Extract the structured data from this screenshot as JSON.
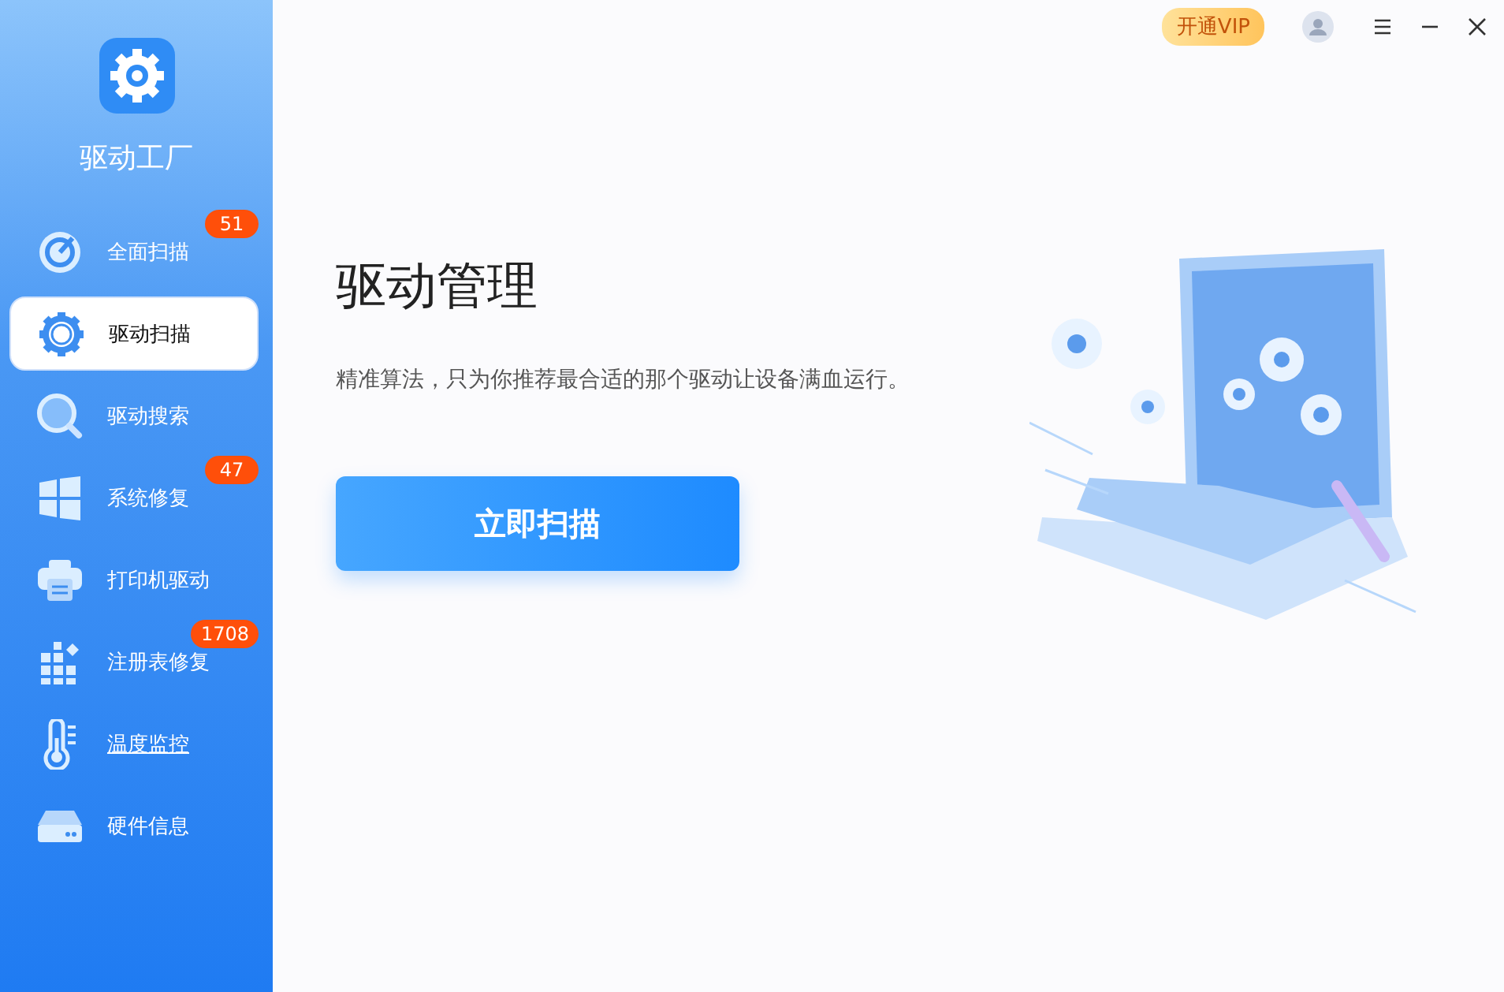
{
  "app": {
    "name": "驱动工厂"
  },
  "sidebar": {
    "items": [
      {
        "label": "全面扫描",
        "badge": "51",
        "selected": false,
        "hovered": false
      },
      {
        "label": "驱动扫描",
        "selected": true,
        "hovered": false
      },
      {
        "label": "驱动搜索",
        "selected": false,
        "hovered": false
      },
      {
        "label": "系统修复",
        "badge": "47",
        "selected": false,
        "hovered": false
      },
      {
        "label": "打印机驱动",
        "selected": false,
        "hovered": false
      },
      {
        "label": "注册表修复",
        "badge": "1708",
        "selected": false,
        "hovered": false
      },
      {
        "label": "温度监控",
        "selected": false,
        "hovered": true
      },
      {
        "label": "硬件信息",
        "selected": false,
        "hovered": false
      }
    ]
  },
  "topbar": {
    "vip_button": "开通VIP"
  },
  "main": {
    "title": "驱动管理",
    "description": "精准算法，只为你推荐最合适的那个驱动让设备满血运行。",
    "scan_button": "立即扫描"
  }
}
